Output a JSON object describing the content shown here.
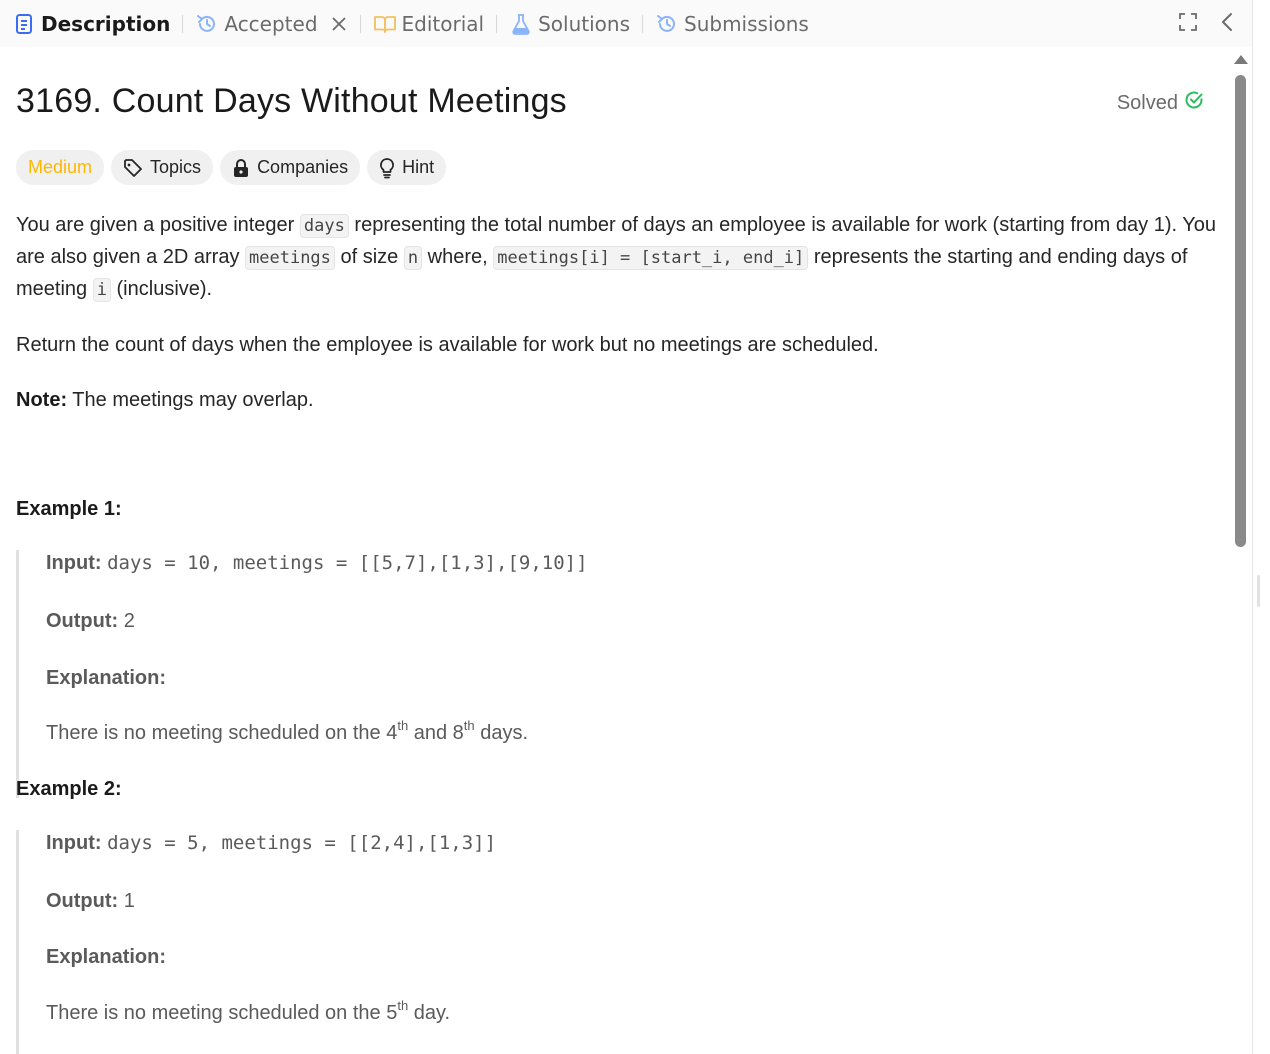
{
  "tabs": {
    "description": "Description",
    "accepted": "Accepted",
    "editorial": "Editorial",
    "solutions": "Solutions",
    "submissions": "Submissions"
  },
  "problem": {
    "title": "3169. Count Days Without Meetings",
    "status": "Solved",
    "difficulty": "Medium",
    "tags": [
      "Topics",
      "Companies",
      "Hint"
    ]
  },
  "statement": {
    "p1_a": "You are given a positive integer ",
    "p1_code1": "days",
    "p1_b": " representing the total number of days an employee is available for work (starting from day 1). You are also given a 2D array ",
    "p1_code2": "meetings",
    "p1_c": " of size ",
    "p1_code3": "n",
    "p1_d": " where, ",
    "p1_code4": "meetings[i] = [start_i, end_i]",
    "p1_e": " represents the starting and ending days of meeting ",
    "p1_code5": "i",
    "p1_f": " (inclusive).",
    "p2": "Return the count of days when the employee is available for work but no meetings are scheduled.",
    "note_label": "Note:",
    "note_text": " The meetings may overlap."
  },
  "examples": [
    {
      "title": "Example 1:",
      "input_label": "Input:",
      "input": "days = 10, meetings = [[5,7],[1,3],[9,10]]",
      "output_label": "Output:",
      "output": "2",
      "explanation_label": "Explanation:",
      "exp_a": "There is no meeting scheduled on the 4",
      "exp_sup1": "th",
      "exp_b": " and 8",
      "exp_sup2": "th",
      "exp_c": " days."
    },
    {
      "title": "Example 2:",
      "input_label": "Input:",
      "input": "days = 5, meetings = [[2,4],[1,3]]",
      "output_label": "Output:",
      "output": "1",
      "explanation_label": "Explanation:",
      "exp_a": "There is no meeting scheduled on the 5",
      "exp_sup1": "th",
      "exp_c": " day."
    }
  ],
  "colors": {
    "medium": "#ffb800",
    "solved": "#2cbb5d",
    "tab_icon": "#8ab4f8",
    "active_icon": "#3a6df0"
  }
}
